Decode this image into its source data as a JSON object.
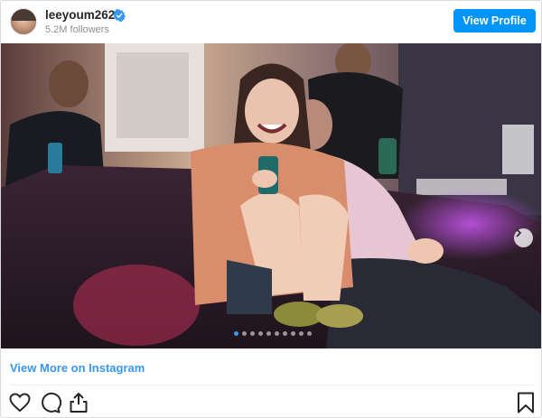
{
  "header": {
    "username": "leeyoum262",
    "followers": "5.2M followers",
    "view_profile_label": "View Profile",
    "verified_color": "#3897f0"
  },
  "post": {
    "carousel": {
      "total_slides": 10,
      "current_slide": 1
    },
    "next_icon": "chevron-right-icon"
  },
  "footer": {
    "view_more_label": "View More on Instagram",
    "actions": [
      "heart-icon",
      "comment-icon",
      "share-icon",
      "bookmark-icon"
    ]
  },
  "colors": {
    "accent": "#0095f6",
    "link": "#3897f0"
  }
}
